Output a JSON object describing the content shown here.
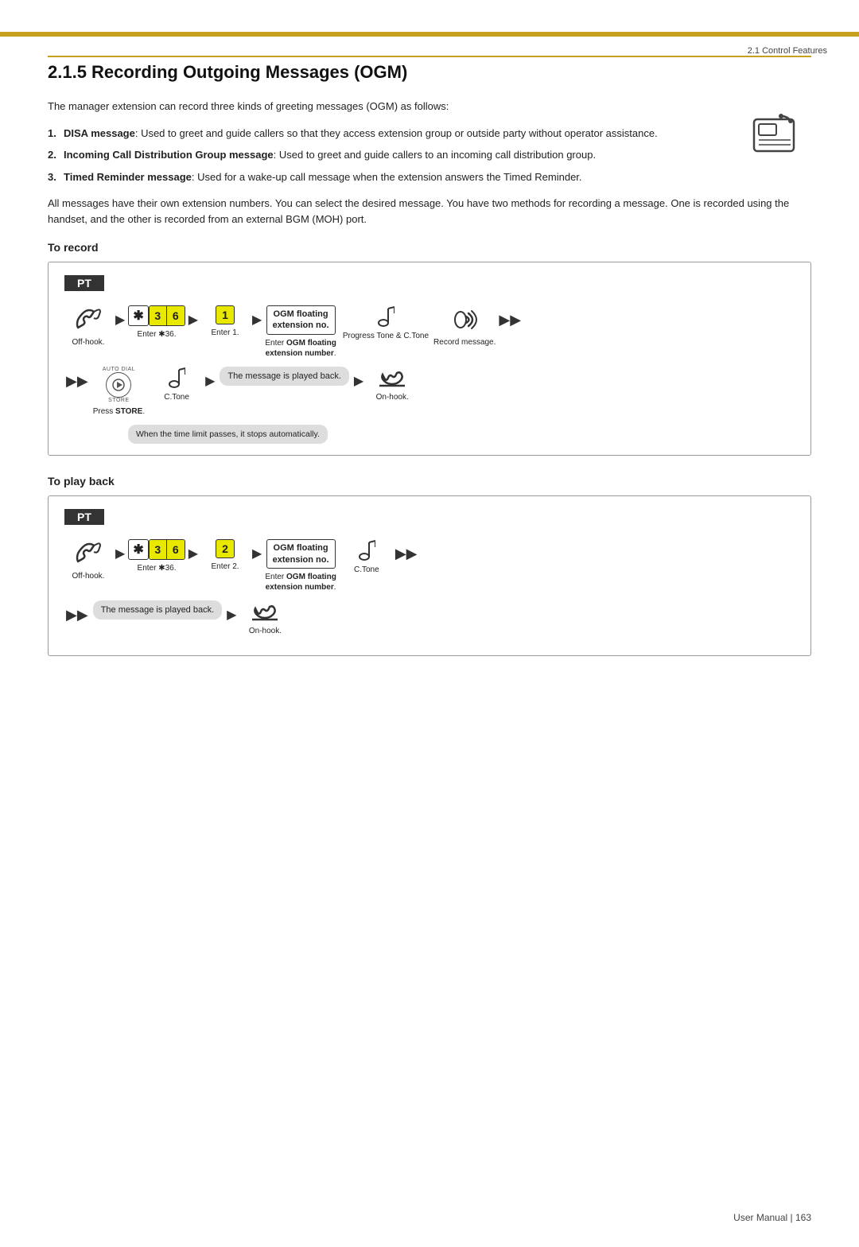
{
  "header": {
    "section_ref": "2.1 Control Features",
    "page_number": "User Manual  |  163"
  },
  "page_title": "2.1.5  Recording Outgoing Messages (OGM)",
  "intro": "The manager extension can record three kinds of greeting messages (OGM) as follows:",
  "bullets": [
    {
      "num": "1.",
      "bold_part": "DISA message",
      "rest": ": Used to greet and guide callers so that they access extension group or outside party without operator assistance."
    },
    {
      "num": "2.",
      "bold_part": "Incoming Call Distribution Group message",
      "rest": ": Used to greet and guide callers to an incoming call distribution group."
    },
    {
      "num": "3.",
      "bold_part": "Timed Reminder message",
      "rest": ": Used for a wake-up call message when the extension answers the Timed Reminder."
    }
  ],
  "all_messages_text": "All messages have their own extension numbers. You can select the desired message. You have two methods for recording a message. One is recorded using the handset, and the other is recorded from an external BGM (MOH) port.",
  "to_record": {
    "title": "To record",
    "pt_label": "PT",
    "row1": {
      "offhook_label": "Off-hook.",
      "enter_36_label": "Enter ✱36.",
      "enter_1_label": "Enter 1.",
      "ogm_label1": "OGM floating",
      "ogm_label2": "extension no.",
      "enter_ogm_label": "Enter OGM floating extension number.",
      "progress_label": "Progress Tone & C.Tone",
      "record_label": "Record message."
    },
    "row2": {
      "press_store_label": "Press STORE.",
      "ctone_label": "C.Tone",
      "message_played": "The message is played back.",
      "onhook_label": "On-hook."
    },
    "note": "When the time limit passes, it stops automatically."
  },
  "to_play_back": {
    "title": "To play back",
    "pt_label": "PT",
    "row1": {
      "offhook_label": "Off-hook.",
      "enter_36_label": "Enter ✱36.",
      "enter_2_label": "Enter 2.",
      "ogm_label1": "OGM floating",
      "ogm_label2": "extension no.",
      "ctone_label": "C.Tone",
      "enter_ogm_label": "Enter OGM floating extension number."
    },
    "row2": {
      "message_played": "The message is played back.",
      "onhook_label": "On-hook."
    }
  },
  "keys": {
    "star": "✱",
    "three": "3",
    "six": "6",
    "one": "1",
    "two": "2"
  }
}
